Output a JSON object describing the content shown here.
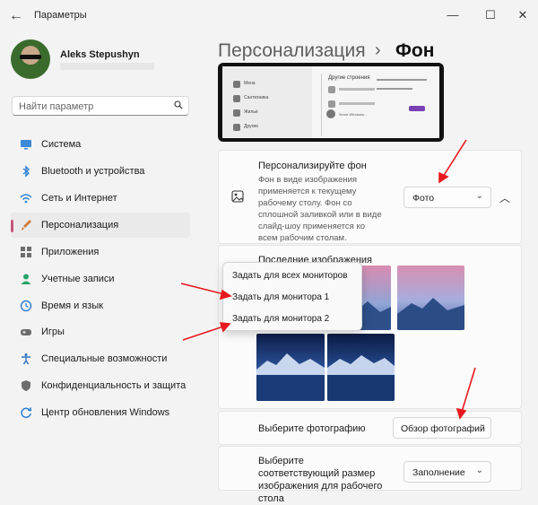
{
  "window": {
    "title": "Параметры",
    "back_icon": "←",
    "minimize_icon": "—",
    "maximize_icon": "☐",
    "close_icon": "✕"
  },
  "user": {
    "name": "Aleks Stepushyn"
  },
  "search": {
    "placeholder": "Найти параметр"
  },
  "sidebar": {
    "items": [
      {
        "label": "Система",
        "icon": "monitor-icon",
        "color": "#3c8ad8"
      },
      {
        "label": "Bluetooth и устройства",
        "icon": "bluetooth-icon",
        "color": "#2d7fd2"
      },
      {
        "label": "Сеть и Интернет",
        "icon": "wifi-icon",
        "color": "#2d7fd2"
      },
      {
        "label": "Персонализация",
        "icon": "brush-icon",
        "color": "#d07b3a"
      },
      {
        "label": "Приложения",
        "icon": "apps-icon",
        "color": "#6d6d6d"
      },
      {
        "label": "Учетные записи",
        "icon": "person-icon",
        "color": "#27a36b"
      },
      {
        "label": "Время и язык",
        "icon": "globe-clock-icon",
        "color": "#2d7fd2"
      },
      {
        "label": "Игры",
        "icon": "gamepad-icon",
        "color": "#6d6d6d"
      },
      {
        "label": "Специальные возможности",
        "icon": "accessibility-icon",
        "color": "#2d6fbf"
      },
      {
        "label": "Конфиденциальность и защита",
        "icon": "shield-icon",
        "color": "#6d6d6d"
      },
      {
        "label": "Центр обновления Windows",
        "icon": "update-icon",
        "color": "#2d7fd2"
      }
    ],
    "active_index": 3,
    "accent": "#c5577a"
  },
  "header": {
    "parent": "Персонализация",
    "separator": "›",
    "current": "Фон"
  },
  "preview": {
    "items": [
      "Мена",
      "Сантехника",
      "Жильё",
      "Другие"
    ],
    "heading": "Другие строения",
    "window_label": "Score Windows..."
  },
  "background_card": {
    "title": "Персонализируйте фон",
    "description": "Фон в виде изображения применяется к текущему рабочему столу. Фон со сплошной заливкой или в виде слайд-шоу применяется ко всем рабочим столам.",
    "dropdown_value": "Фото",
    "collapse_icon": "︿"
  },
  "recent": {
    "title": "Последние изображения"
  },
  "context_menu": {
    "items": [
      "Задать для всех мониторов",
      "Задать для монитора 1",
      "Задать для монитора 2"
    ]
  },
  "choose_photo": {
    "label": "Выберите фотографию",
    "button": "Обзор фотографий"
  },
  "fit": {
    "label": "Выберите соответствующий размер изображения для рабочего стола",
    "value": "Заполнение"
  },
  "annotation_color": "#e8191d"
}
